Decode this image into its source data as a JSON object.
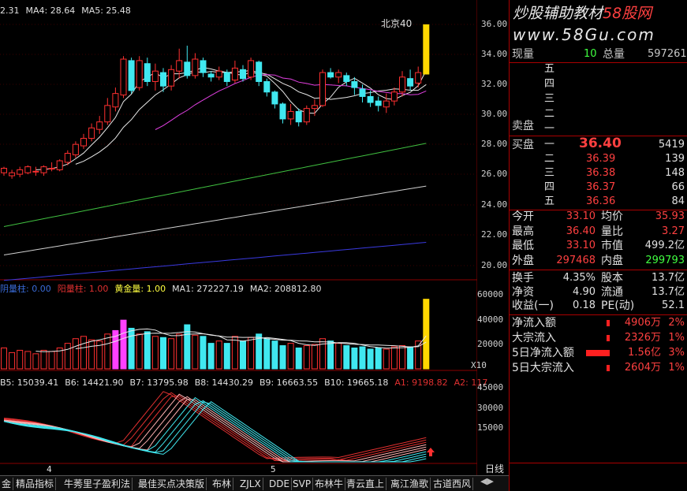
{
  "watermark": {
    "line1": "炒股辅助教材",
    "brand": "58股网",
    "line2": "www.58Gu.com"
  },
  "top_note": "北京40",
  "price_axis": [
    "36.00",
    "34.00",
    "32.00",
    "30.00",
    "28.00",
    "26.00",
    "24.00",
    "22.00",
    "20.00"
  ],
  "vol_axis": [
    "60000",
    "40000",
    "20000"
  ],
  "osc_axis": [
    "45000",
    "30000",
    "15000"
  ],
  "vol_unit": "X10",
  "ma_legend": [
    {
      "text": "2.31",
      "color": "#e0e0e0"
    },
    {
      "text": "MA4: 28.64",
      "color": "#e0e0e0"
    },
    {
      "text": "MA5: 25.48",
      "color": "#e0e0e0"
    }
  ],
  "vol_legend": [
    {
      "text": "阴量柱: 0.00",
      "color": "#3a6bd8"
    },
    {
      "text": "阳量柱: 1.00",
      "color": "#e03030"
    },
    {
      "text": "黄金量: 1.00",
      "color": "#ffff40"
    },
    {
      "text": "MA1: 272227.19",
      "color": "#e0e0e0"
    },
    {
      "text": "MA2: 208812.80",
      "color": "#e0e0e0"
    }
  ],
  "osc_legend": [
    {
      "text": "B5: 15039.41",
      "color": "#e0e0e0"
    },
    {
      "text": "B6: 14421.90",
      "color": "#e0e0e0"
    },
    {
      "text": "B7: 13795.98",
      "color": "#e0e0e0"
    },
    {
      "text": "B8: 14430.29",
      "color": "#e0e0e0"
    },
    {
      "text": "B9: 16663.55",
      "color": "#e0e0e0"
    },
    {
      "text": "B10: 19665.18",
      "color": "#e0e0e0"
    },
    {
      "text": "A1: 9198.82",
      "color": "#e03030"
    },
    {
      "text": "A2: 117",
      "color": "#e03030"
    }
  ],
  "month_labels": [
    "4",
    "5"
  ],
  "panel": {
    "xianliang_label": "现量",
    "xianliang": "10",
    "zongliang_label": "总量",
    "zongliang": "597261",
    "sell_levels": [
      "五",
      "四",
      "三",
      "二",
      "一"
    ],
    "sell_label": "卖盘",
    "buy_label": "买盘",
    "buy_levels": [
      {
        "lvl": "一",
        "price": "36.40",
        "vol": "5419"
      },
      {
        "lvl": "二",
        "price": "36.39",
        "vol": "139"
      },
      {
        "lvl": "三",
        "price": "36.38",
        "vol": "148"
      },
      {
        "lvl": "四",
        "price": "36.37",
        "vol": "66"
      },
      {
        "lvl": "五",
        "price": "36.36",
        "vol": "84"
      }
    ],
    "stats": [
      {
        "k1": "今开",
        "v1": "33.10",
        "c1": "#ff4040",
        "k2": "均价",
        "v2": "35.93",
        "c2": "#ff4040"
      },
      {
        "k1": "最高",
        "v1": "36.40",
        "c1": "#ff4040",
        "k2": "量比",
        "v2": "3.27",
        "c2": "#ff4040"
      },
      {
        "k1": "最低",
        "v1": "33.10",
        "c1": "#ff4040",
        "k2": "市值",
        "v2": "499.2亿",
        "c2": "#e0e0e0"
      },
      {
        "k1": "外盘",
        "v1": "297468",
        "c1": "#ff4040",
        "k2": "内盘",
        "v2": "299793",
        "c2": "#40ff40"
      }
    ],
    "stats2": [
      {
        "k1": "换手",
        "v1": "4.35%",
        "c1": "#e0e0e0",
        "k2": "股本",
        "v2": "13.7亿",
        "c2": "#e0e0e0"
      },
      {
        "k1": "净资",
        "v1": "4.90",
        "c1": "#e0e0e0",
        "k2": "流通",
        "v2": "13.7亿",
        "c2": "#e0e0e0"
      },
      {
        "k1": "收益(一)",
        "v1": "0.18",
        "c1": "#e0e0e0",
        "k2": "PE(动)",
        "v2": "52.1",
        "c2": "#e0e0e0"
      }
    ],
    "flows": [
      {
        "label": "净流入额",
        "value": "4906万",
        "pct": "2%",
        "bar": 0.12
      },
      {
        "label": "大宗流入",
        "value": "2326万",
        "pct": "1%",
        "bar": 0.06
      },
      {
        "label": "5日净流入额",
        "value": "1.56亿",
        "pct": "3%",
        "bar": 0.95
      },
      {
        "label": "5日大宗流入",
        "value": "2604万",
        "pct": "1%",
        "bar": 0.06
      }
    ],
    "period": "日线"
  },
  "tabs": [
    "金",
    "精品指标",
    "牛莠里子盈利法",
    "最佳买点决策版",
    "布林",
    "ZJLX",
    "DDE",
    "SVP",
    "布林牛",
    "青云直上",
    "离江渔歌",
    "古道西风"
  ],
  "chart_data": {
    "type": "candlestick",
    "ylim": [
      19.5,
      37.0
    ],
    "candles": [
      [
        26.5,
        26.8,
        26.3,
        26.9
      ],
      [
        26.3,
        26.5,
        26.1,
        26.7
      ],
      [
        26.4,
        26.7,
        26.2,
        26.9
      ],
      [
        26.5,
        26.9,
        26.4,
        27.0
      ],
      [
        26.6,
        26.6,
        26.3,
        26.9
      ],
      [
        26.5,
        26.9,
        26.3,
        27.0
      ],
      [
        26.8,
        26.8,
        26.6,
        27.2
      ],
      [
        26.7,
        27.3,
        26.6,
        27.4
      ],
      [
        27.2,
        27.8,
        27.0,
        28.0
      ],
      [
        27.7,
        28.4,
        27.5,
        28.6
      ],
      [
        28.3,
        28.8,
        28.1,
        29.1
      ],
      [
        28.8,
        29.5,
        28.6,
        29.8
      ],
      [
        29.4,
        29.9,
        29.1,
        30.3
      ],
      [
        29.9,
        31.0,
        29.7,
        31.5
      ],
      [
        30.9,
        31.8,
        30.6,
        32.2
      ],
      [
        31.7,
        34.1,
        31.5,
        34.3
      ],
      [
        34.0,
        32.0,
        31.8,
        34.2
      ],
      [
        32.2,
        34.0,
        32.0,
        34.3
      ],
      [
        33.8,
        32.6,
        32.3,
        34.2
      ],
      [
        32.6,
        33.3,
        32.0,
        33.8
      ],
      [
        33.2,
        32.3,
        31.9,
        33.5
      ],
      [
        32.3,
        33.4,
        32.0,
        33.7
      ],
      [
        33.3,
        34.0,
        32.8,
        34.8
      ],
      [
        33.9,
        33.0,
        32.8,
        35.0
      ],
      [
        33.0,
        34.1,
        32.8,
        34.5
      ],
      [
        34.0,
        33.2,
        32.9,
        34.2
      ],
      [
        33.1,
        32.9,
        32.6,
        33.3
      ],
      [
        32.9,
        33.3,
        32.7,
        33.6
      ],
      [
        33.2,
        32.6,
        32.3,
        33.4
      ],
      [
        32.7,
        33.5,
        32.5,
        34.0
      ],
      [
        33.4,
        32.8,
        32.6,
        33.7
      ],
      [
        32.9,
        34.0,
        32.7,
        34.2
      ],
      [
        33.9,
        32.6,
        32.3,
        34.0
      ],
      [
        32.6,
        31.9,
        31.6,
        32.8
      ],
      [
        31.9,
        31.1,
        30.8,
        32.0
      ],
      [
        31.1,
        30.1,
        29.8,
        31.2
      ],
      [
        30.1,
        30.6,
        29.7,
        31.1
      ],
      [
        30.6,
        29.9,
        29.6,
        30.8
      ],
      [
        29.9,
        30.8,
        29.7,
        31.0
      ],
      [
        30.8,
        31.0,
        30.3,
        31.4
      ],
      [
        31.0,
        33.2,
        30.9,
        33.4
      ],
      [
        33.2,
        32.9,
        32.8,
        33.5
      ],
      [
        32.9,
        33.2,
        32.5,
        33.4
      ],
      [
        33.0,
        32.6,
        32.3,
        33.2
      ],
      [
        32.6,
        32.2,
        31.7,
        32.9
      ],
      [
        32.1,
        31.6,
        31.2,
        32.4
      ],
      [
        31.6,
        31.2,
        30.9,
        32.0
      ],
      [
        31.3,
        31.0,
        30.6,
        31.6
      ],
      [
        30.9,
        31.3,
        30.5,
        31.8
      ],
      [
        31.3,
        31.9,
        31.0,
        32.2
      ],
      [
        31.9,
        32.9,
        31.6,
        33.3
      ],
      [
        32.8,
        32.3,
        32.0,
        33.4
      ],
      [
        32.5,
        33.2,
        32.2,
        33.6
      ],
      [
        33.1,
        36.4,
        33.1,
        36.4
      ]
    ],
    "volumes": [
      18000,
      14000,
      16000,
      15000,
      13000,
      16000,
      15000,
      18000,
      22000,
      26000,
      28000,
      25000,
      24000,
      30000,
      33000,
      42000,
      35000,
      30000,
      32000,
      28000,
      27000,
      26000,
      30000,
      38000,
      29000,
      28000,
      22000,
      24000,
      22000,
      28000,
      24000,
      27000,
      30000,
      26000,
      24000,
      20000,
      22000,
      18000,
      20000,
      21000,
      26000,
      24000,
      22000,
      20000,
      18000,
      19000,
      17000,
      18000,
      17000,
      19000,
      20000,
      19000,
      24000,
      60000
    ],
    "vol_ylim": [
      0,
      72000
    ]
  }
}
